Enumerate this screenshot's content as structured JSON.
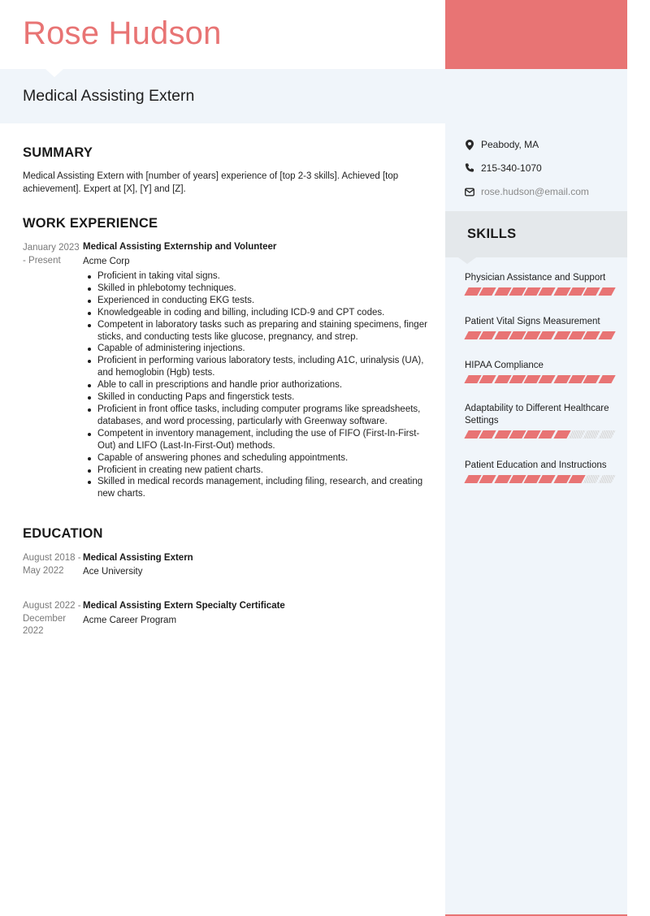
{
  "header": {
    "name": "Rose Hudson",
    "job_title": "Medical Assisting Extern",
    "accent_color": "#e87474"
  },
  "contact": {
    "location": {
      "icon": "map-pin-icon",
      "text": "Peabody, MA"
    },
    "phone": {
      "icon": "phone-icon",
      "text": "215-340-1070"
    },
    "email": {
      "icon": "envelope-icon",
      "text": "rose.hudson@email.com"
    }
  },
  "skills": {
    "heading": "SKILLS",
    "items": [
      {
        "name": "Physician Assistance and Support",
        "level": 10,
        "max": 10
      },
      {
        "name": "Patient Vital Signs Measurement",
        "level": 10,
        "max": 10
      },
      {
        "name": "HIPAA Compliance",
        "level": 10,
        "max": 10
      },
      {
        "name": "Adaptability to Different Healthcare Settings",
        "level": 7,
        "max": 10
      },
      {
        "name": "Patient Education and Instructions",
        "level": 8,
        "max": 10
      }
    ]
  },
  "summary": {
    "heading": "SUMMARY",
    "text": "Medical Assisting Extern with [number of years] experience of [top 2-3 skills]. Achieved [top achievement]. Expert at [X], [Y] and [Z]."
  },
  "experience": {
    "heading": "WORK EXPERIENCE",
    "items": [
      {
        "date": "January 2023 - Present",
        "title": "Medical Assisting Externship and Volunteer",
        "org": "Acme Corp",
        "bullets": [
          "Proficient in taking vital signs.",
          "Skilled in phlebotomy techniques.",
          "Experienced in conducting EKG tests.",
          "Knowledgeable in coding and billing, including ICD-9 and CPT codes.",
          "Competent in laboratory tasks such as preparing and staining specimens, finger sticks, and conducting tests like glucose, pregnancy, and strep.",
          "Capable of administering injections.",
          "Proficient in performing various laboratory tests, including A1C, urinalysis (UA), and hemoglobin (Hgb) tests.",
          "Able to call in prescriptions and handle prior authorizations.",
          "Skilled in conducting Paps and fingerstick tests.",
          "Proficient in front office tasks, including computer programs like spreadsheets, databases, and word processing, particularly with Greenway software.",
          "Competent in inventory management, including the use of FIFO (First-In-First-Out) and LIFO (Last-In-First-Out) methods.",
          "Capable of answering phones and scheduling appointments.",
          "Proficient in creating new patient charts.",
          "Skilled in medical records management, including filing, research, and creating new charts."
        ]
      }
    ]
  },
  "education": {
    "heading": "EDUCATION",
    "items": [
      {
        "date": "August 2018 - May 2022",
        "title": "Medical Assisting Extern",
        "org": "Ace University"
      },
      {
        "date": "August 2022 - December 2022",
        "title": "Medical Assisting Extern Specialty Certificate",
        "org": "Acme Career Program"
      }
    ]
  }
}
